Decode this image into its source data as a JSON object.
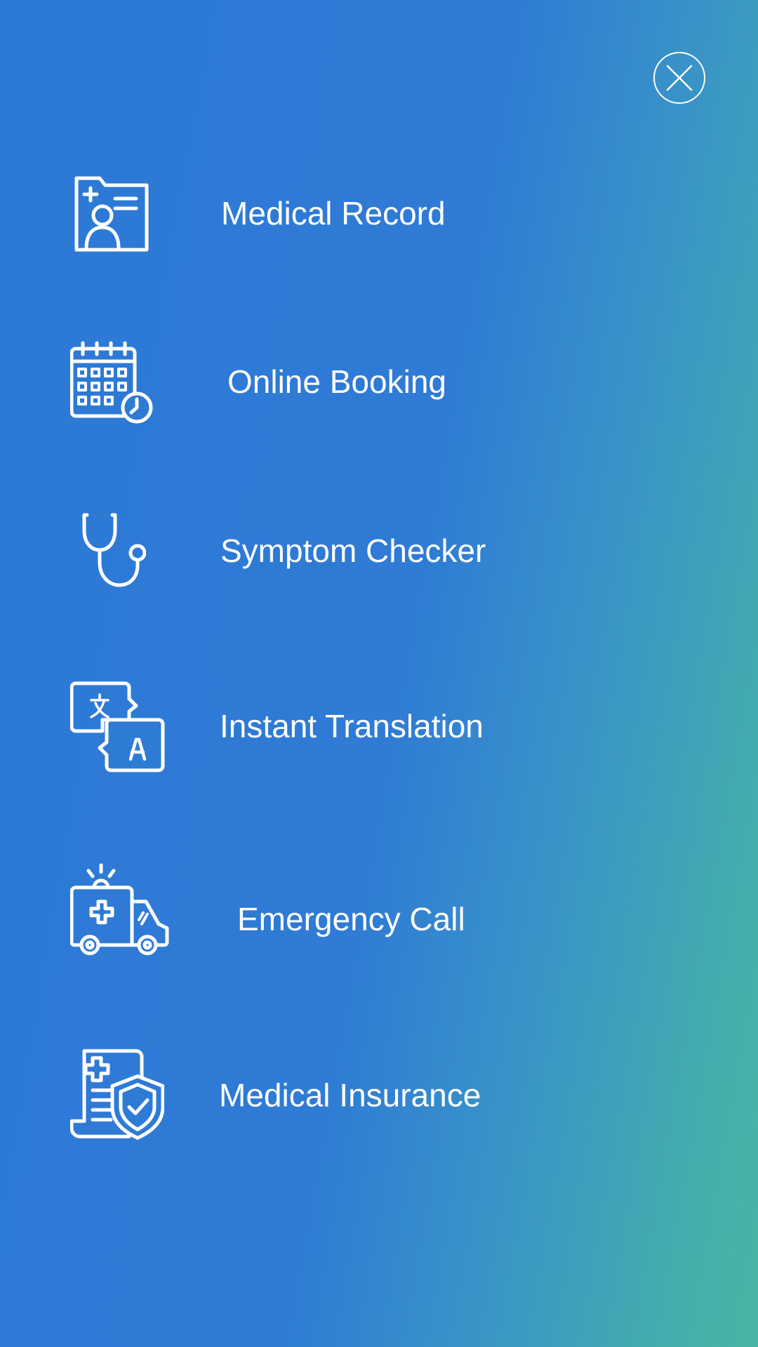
{
  "close": {
    "icon": "close-icon"
  },
  "menu": [
    {
      "label": "Medical Record",
      "icon": "medical-record-icon"
    },
    {
      "label": "Online Booking",
      "icon": "calendar-clock-icon"
    },
    {
      "label": "Symptom Checker",
      "icon": "stethoscope-icon"
    },
    {
      "label": "Instant Translation",
      "icon": "translate-icon"
    },
    {
      "label": "Emergency Call",
      "icon": "ambulance-icon"
    },
    {
      "label": "Medical Insurance",
      "icon": "insurance-shield-icon"
    }
  ],
  "colors": {
    "gradient_start": "#2c78d6",
    "gradient_end": "#48b5a4",
    "foreground": "#ffffff"
  }
}
